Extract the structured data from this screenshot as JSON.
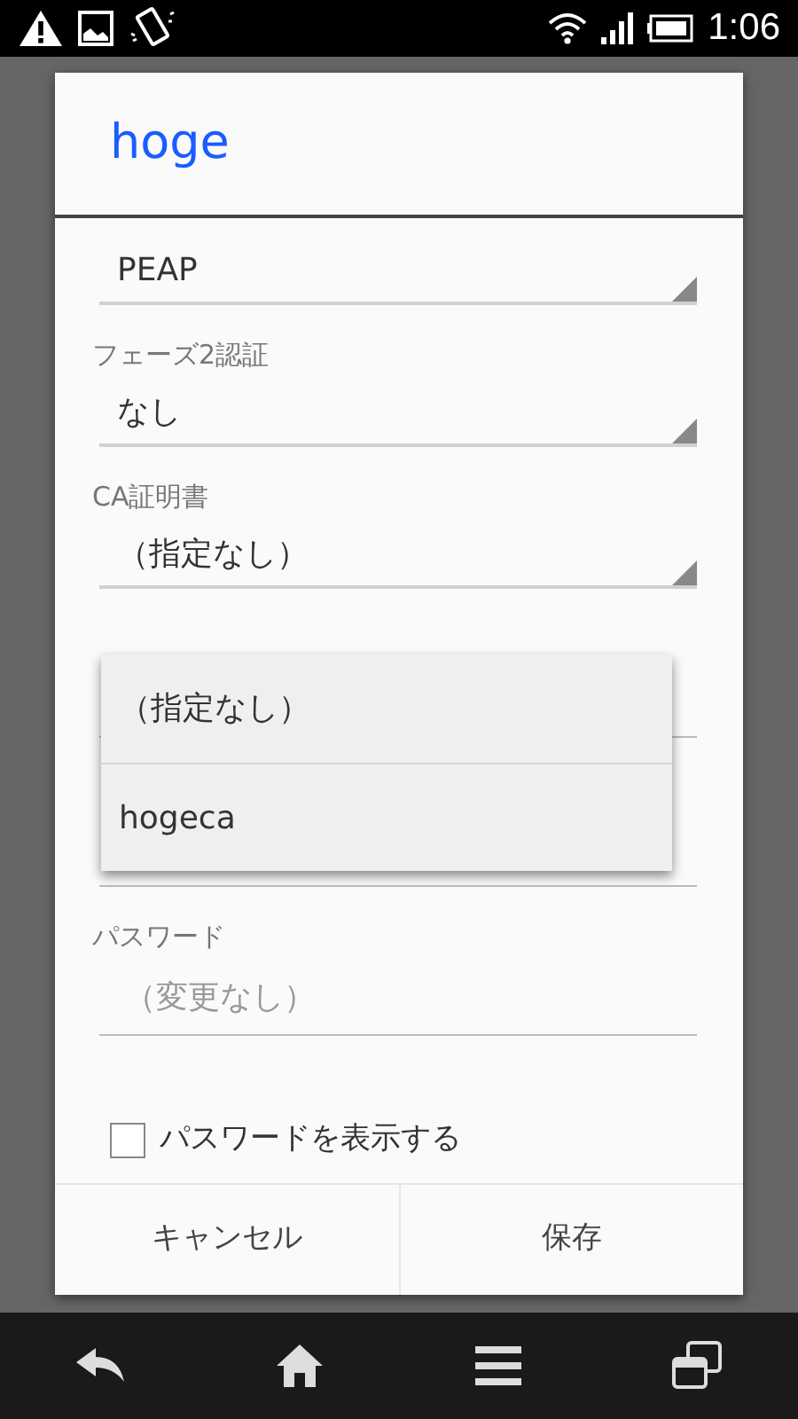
{
  "status_bar": {
    "time": "1:06"
  },
  "dialog": {
    "title": "hoge",
    "fields": [
      {
        "kind": "spinner",
        "value": "PEAP"
      },
      {
        "kind": "spinner",
        "label": "フェーズ2認証",
        "value": "なし"
      },
      {
        "kind": "spinner",
        "label": "CA証明書",
        "value": "（指定なし）"
      },
      {
        "kind": "text"
      },
      {
        "kind": "text"
      },
      {
        "kind": "text",
        "label": "パスワード",
        "placeholder": "（変更なし）"
      }
    ],
    "show_password": {
      "label": "パスワードを表示する",
      "checked": false
    },
    "buttons": [
      "キャンセル",
      "保存"
    ]
  },
  "dropdown": {
    "options": [
      "（指定なし）",
      "hogeca"
    ]
  }
}
